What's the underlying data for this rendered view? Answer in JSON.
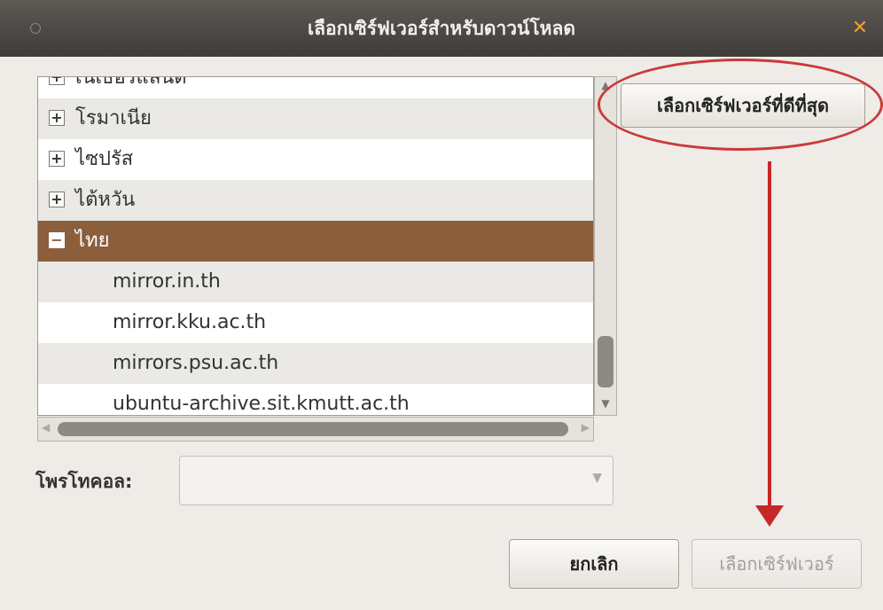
{
  "window": {
    "title": "เลือกเซิร์ฟเวอร์สำหรับดาวน์โหลด"
  },
  "server_list": {
    "rows": [
      {
        "label": "เนเธอร์แลนด์",
        "expander": "+",
        "kind": "country",
        "selected": false
      },
      {
        "label": "โรมาเนีย",
        "expander": "+",
        "kind": "country",
        "selected": false
      },
      {
        "label": "ไซปรัส",
        "expander": "+",
        "kind": "country",
        "selected": false
      },
      {
        "label": "ไต้หวัน",
        "expander": "+",
        "kind": "country",
        "selected": false
      },
      {
        "label": "ไทย",
        "expander": "−",
        "kind": "country",
        "selected": true
      },
      {
        "label": "mirror.in.th",
        "kind": "server",
        "selected": false
      },
      {
        "label": "mirror.kku.ac.th",
        "kind": "server",
        "selected": false
      },
      {
        "label": "mirrors.psu.ac.th",
        "kind": "server",
        "selected": false
      },
      {
        "label": "ubuntu-archive.sit.kmutt.ac.th",
        "kind": "server",
        "selected": false
      }
    ]
  },
  "best_server_button": {
    "label": "เลือกเซิร์ฟเวอร์ที่ดีที่สุด"
  },
  "protocol": {
    "label": "โพรโทคอล:",
    "value": ""
  },
  "buttons": {
    "cancel": "ยกเลิก",
    "choose": "เลือกเซิร์ฟเวอร์"
  },
  "colors": {
    "selection": "#8b5e3c",
    "annotation": "#c62828",
    "close": "#f29b2a"
  }
}
